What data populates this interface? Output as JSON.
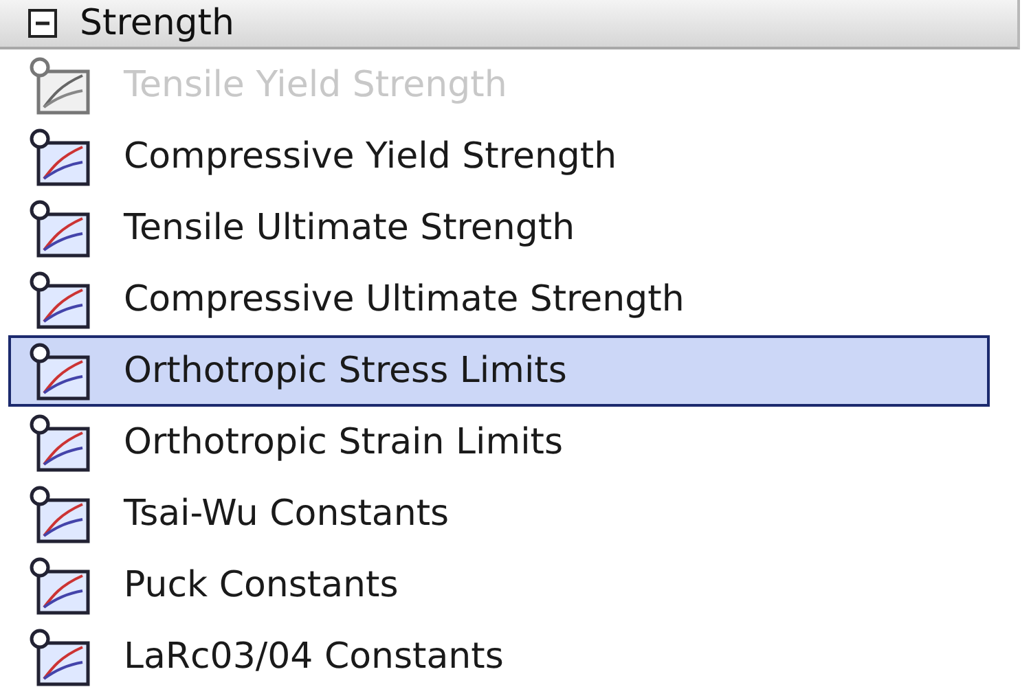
{
  "group": {
    "title": "Strength",
    "expanded": true
  },
  "items": [
    {
      "label": "Tensile Yield Strength",
      "disabled": true,
      "selected": false
    },
    {
      "label": "Compressive Yield Strength",
      "disabled": false,
      "selected": false
    },
    {
      "label": "Tensile Ultimate Strength",
      "disabled": false,
      "selected": false
    },
    {
      "label": "Compressive Ultimate Strength",
      "disabled": false,
      "selected": false
    },
    {
      "label": "Orthotropic Stress Limits",
      "disabled": false,
      "selected": true
    },
    {
      "label": "Orthotropic Strain Limits",
      "disabled": false,
      "selected": false
    },
    {
      "label": "Tsai-Wu Constants",
      "disabled": false,
      "selected": false
    },
    {
      "label": "Puck Constants",
      "disabled": false,
      "selected": false
    },
    {
      "label": "LaRc03/04 Constants",
      "disabled": false,
      "selected": false
    }
  ]
}
